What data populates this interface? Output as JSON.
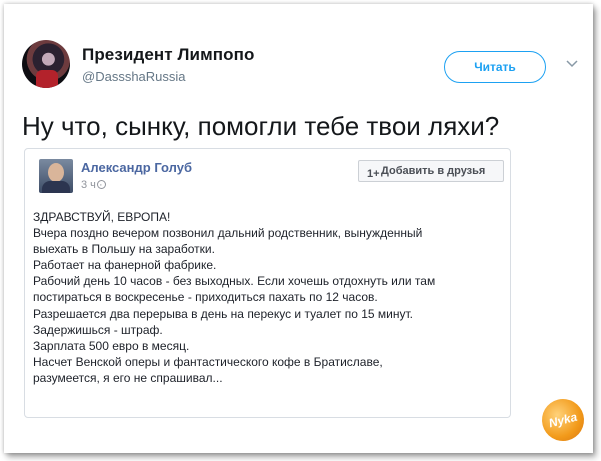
{
  "tweet": {
    "author_name": "Президент Лимпопо",
    "author_handle": "@DassshaRussia",
    "follow_label": "Читать",
    "text": "Ну что, сынку, помогли тебе твои ляхи?"
  },
  "embedded_post": {
    "author_name": "Александр Голуб",
    "time": "3 ч ·",
    "add_friend_label": "Добавить в друзья",
    "add_friend_icon": "1+",
    "lines": [
      "ЗДРАВСТВУЙ, ЕВРОПА!",
      "Вчера поздно вечером позвонил дальний родственник, вынужденный",
      "выехать в Польшу на заработки.",
      "Работает на фанерной фабрике.",
      "Рабочий день 10 часов - без выходных. Если хочешь отдохнуть или там",
      "постираться в воскресенье - приходиться пахать по 12 часов.",
      "Разрешается два перерыва в день на перекус и туалет по 15 минут.",
      "Задержишься - штраф.",
      "Зарплата 500 евро в месяц.",
      "Насчет Венской оперы и фантастического кофе в Братиславе,",
      "разумеется, я его не спрашивал..."
    ]
  },
  "watermark": {
    "text": "Nyka"
  },
  "colors": {
    "twitter_blue": "#1da1f2",
    "facebook_blue": "#4b67a1"
  },
  "icons": {
    "more": "chevron-down-icon",
    "privacy": "globe-icon"
  }
}
